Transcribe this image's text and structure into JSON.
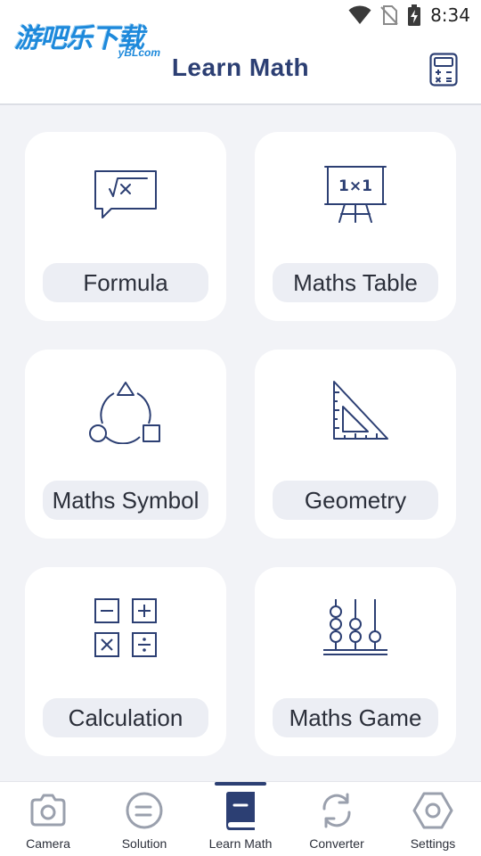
{
  "status_bar": {
    "time": "8:34",
    "icons": [
      "wifi-icon",
      "no-sim-icon",
      "battery-charging-icon"
    ]
  },
  "watermark": {
    "text": "游吧乐下载",
    "domain": "yBLcom"
  },
  "header": {
    "title": "Learn Math",
    "action_icon": "calculator-icon"
  },
  "cards": [
    {
      "label": "Formula",
      "icon": "formula-icon"
    },
    {
      "label": "Maths Table",
      "icon": "maths-table-icon"
    },
    {
      "label": "Maths Symbol",
      "icon": "maths-symbol-icon"
    },
    {
      "label": "Geometry",
      "icon": "geometry-icon"
    },
    {
      "label": "Calculation",
      "icon": "calculation-icon"
    },
    {
      "label": "Maths Game",
      "icon": "abacus-icon"
    }
  ],
  "bottom_nav": {
    "active_index": 2,
    "items": [
      {
        "label": "Camera",
        "icon": "camera-icon"
      },
      {
        "label": "Solution",
        "icon": "solution-icon"
      },
      {
        "label": "Learn Math",
        "icon": "book-icon"
      },
      {
        "label": "Converter",
        "icon": "converter-icon"
      },
      {
        "label": "Settings",
        "icon": "settings-icon"
      }
    ]
  },
  "colors": {
    "accent": "#2c3f73",
    "inactive_icon": "#9aa0ad",
    "background": "#f2f3f7",
    "card": "#ffffff",
    "label_pill": "#eceef4"
  }
}
